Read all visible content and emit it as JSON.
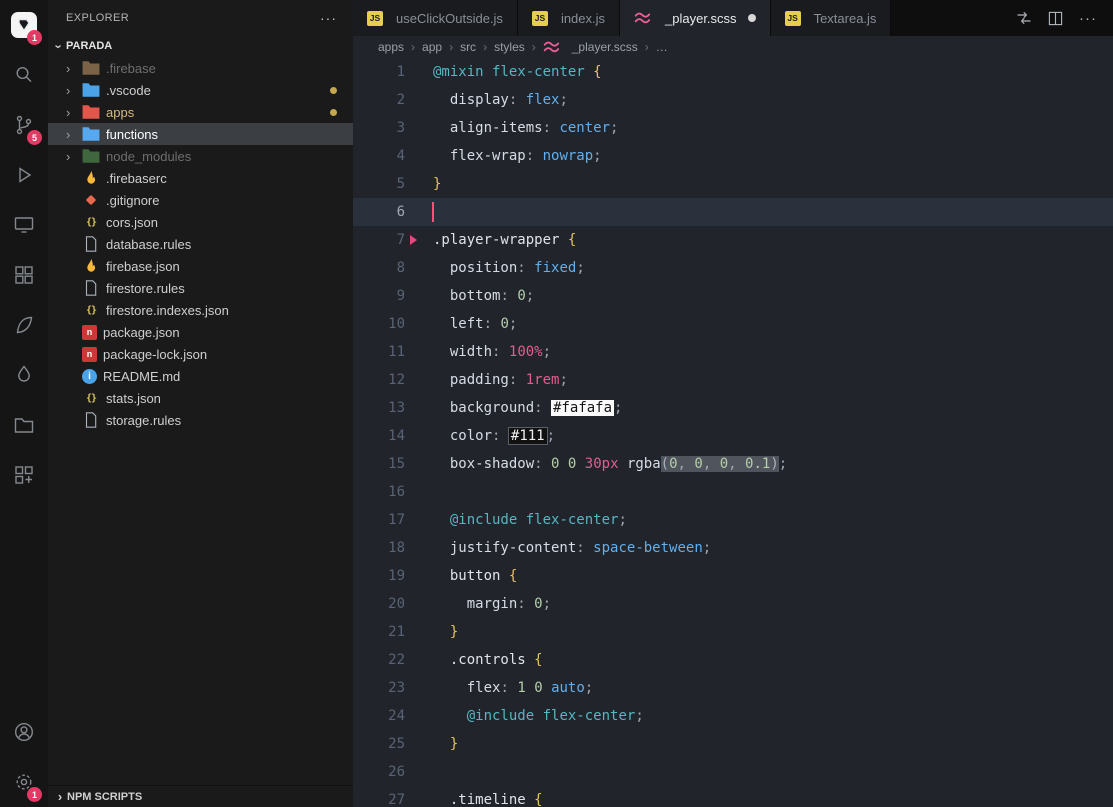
{
  "ui": {
    "more_icon": "···",
    "chevron": "›"
  },
  "activity_bar": {
    "top": [
      {
        "name": "explorer",
        "icon": "app-logo",
        "badge": "1",
        "active": true
      },
      {
        "name": "search",
        "icon": "search"
      },
      {
        "name": "source-control",
        "icon": "source-control",
        "badge": "5"
      },
      {
        "name": "run-debug",
        "icon": "run-debug"
      },
      {
        "name": "remote-explorer",
        "icon": "monitor"
      },
      {
        "name": "extensions",
        "icon": "extensions"
      },
      {
        "name": "extension-a",
        "icon": "leaf"
      },
      {
        "name": "extension-b",
        "icon": "droplet"
      },
      {
        "name": "project-manager",
        "icon": "folder-outline"
      },
      {
        "name": "extension-c",
        "icon": "grid"
      }
    ],
    "bottom": [
      {
        "name": "accounts",
        "icon": "account"
      },
      {
        "name": "settings",
        "icon": "gear",
        "badge": "1"
      }
    ]
  },
  "sidebar": {
    "title": "EXPLORER",
    "section": "PARADA",
    "footer": "NPM SCRIPTS",
    "tree": [
      {
        "label": ".firebase",
        "icon": "folder",
        "iconColor": "#c9a06a",
        "chevron": true,
        "dim": true
      },
      {
        "label": ".vscode",
        "icon": "folder",
        "iconColor": "#4aa3e8",
        "chevron": true,
        "dot": true
      },
      {
        "label": "apps",
        "icon": "folder",
        "iconColor": "#e2574c",
        "chevron": true,
        "dot": true,
        "modified": true
      },
      {
        "label": "functions",
        "icon": "folder",
        "iconColor": "#56a8f0",
        "chevron": true,
        "selected": true
      },
      {
        "label": "node_modules",
        "icon": "folder",
        "iconColor": "#5fa55f",
        "chevron": true,
        "dim": true
      },
      {
        "label": ".firebaserc",
        "icon": "flame",
        "iconColor": "#f6b93c"
      },
      {
        "label": ".gitignore",
        "icon": "git",
        "iconColor": "#e8694d"
      },
      {
        "label": "cors.json",
        "icon": "braces",
        "iconColor": "#d9c462"
      },
      {
        "label": "database.rules",
        "icon": "file",
        "iconColor": "#aab2bd"
      },
      {
        "label": "firebase.json",
        "icon": "flame",
        "iconColor": "#f6b93c"
      },
      {
        "label": "firestore.rules",
        "icon": "file",
        "iconColor": "#aab2bd"
      },
      {
        "label": "firestore.indexes.json",
        "icon": "braces",
        "iconColor": "#d9c462"
      },
      {
        "label": "package.json",
        "icon": "npm",
        "iconColor": "#cb3837"
      },
      {
        "label": "package-lock.json",
        "icon": "npm",
        "iconColor": "#cb3837"
      },
      {
        "label": "README.md",
        "icon": "info",
        "iconColor": "#4aa3e8"
      },
      {
        "label": "stats.json",
        "icon": "braces",
        "iconColor": "#d9c462"
      },
      {
        "label": "storage.rules",
        "icon": "file",
        "iconColor": "#aab2bd"
      }
    ]
  },
  "editor": {
    "tabs": [
      {
        "label": "useClickOutside.js",
        "icon": "js"
      },
      {
        "label": "index.js",
        "icon": "js"
      },
      {
        "label": "_player.scss",
        "icon": "sass",
        "active": true,
        "modified": true
      },
      {
        "label": "Textarea.js",
        "icon": "js"
      }
    ],
    "actions": [
      {
        "name": "open-changes"
      },
      {
        "name": "split-editor"
      },
      {
        "name": "more-actions"
      }
    ],
    "breadcrumbs": [
      {
        "label": "apps"
      },
      {
        "label": "app"
      },
      {
        "label": "src"
      },
      {
        "label": "styles"
      },
      {
        "label": "_player.scss",
        "icon": "sass"
      },
      {
        "label": "…"
      }
    ]
  },
  "code": {
    "language": "scss",
    "lines": [
      {
        "n": 1,
        "tokens": [
          [
            "@mixin",
            "at"
          ],
          [
            " "
          ],
          [
            "flex-center",
            "at"
          ],
          [
            " "
          ],
          [
            "{",
            "brace"
          ]
        ]
      },
      {
        "n": 2,
        "tokens": [
          [
            "  "
          ],
          [
            "display",
            "prop"
          ],
          [
            ":",
            "punct"
          ],
          [
            " "
          ],
          [
            "flex",
            "val"
          ],
          [
            ";",
            "punct"
          ]
        ]
      },
      {
        "n": 3,
        "tokens": [
          [
            "  "
          ],
          [
            "align-items",
            "prop"
          ],
          [
            ":",
            "punct"
          ],
          [
            " "
          ],
          [
            "center",
            "val"
          ],
          [
            ";",
            "punct"
          ]
        ]
      },
      {
        "n": 4,
        "tokens": [
          [
            "  "
          ],
          [
            "flex-wrap",
            "prop"
          ],
          [
            ":",
            "punct"
          ],
          [
            " "
          ],
          [
            "nowrap",
            "val"
          ],
          [
            ";",
            "punct"
          ]
        ]
      },
      {
        "n": 5,
        "tokens": [
          [
            "}",
            "brace"
          ]
        ]
      },
      {
        "n": 6,
        "current": true,
        "cursor": true,
        "tokens": []
      },
      {
        "n": 7,
        "marker": true,
        "tokens": [
          [
            ".player-wrapper",
            "sel"
          ],
          [
            " "
          ],
          [
            "{",
            "brace"
          ]
        ]
      },
      {
        "n": 8,
        "tokens": [
          [
            "  "
          ],
          [
            "position",
            "prop"
          ],
          [
            ":",
            "punct"
          ],
          [
            " "
          ],
          [
            "fixed",
            "val"
          ],
          [
            ";",
            "punct"
          ]
        ]
      },
      {
        "n": 9,
        "tokens": [
          [
            "  "
          ],
          [
            "bottom",
            "prop"
          ],
          [
            ":",
            "punct"
          ],
          [
            " "
          ],
          [
            "0",
            "num"
          ],
          [
            ";",
            "punct"
          ]
        ]
      },
      {
        "n": 10,
        "tokens": [
          [
            "  "
          ],
          [
            "left",
            "prop"
          ],
          [
            ":",
            "punct"
          ],
          [
            " "
          ],
          [
            "0",
            "num"
          ],
          [
            ";",
            "punct"
          ]
        ]
      },
      {
        "n": 11,
        "tokens": [
          [
            "  "
          ],
          [
            "width",
            "prop"
          ],
          [
            ":",
            "punct"
          ],
          [
            " "
          ],
          [
            "100%",
            "unit"
          ],
          [
            ";",
            "punct"
          ]
        ]
      },
      {
        "n": 12,
        "tokens": [
          [
            "  "
          ],
          [
            "padding",
            "prop"
          ],
          [
            ":",
            "punct"
          ],
          [
            " "
          ],
          [
            "1rem",
            "unit"
          ],
          [
            ";",
            "punct"
          ]
        ]
      },
      {
        "n": 13,
        "tokens": [
          [
            "  "
          ],
          [
            "background",
            "prop"
          ],
          [
            ":",
            "punct"
          ],
          [
            " "
          ],
          [
            "#fafafa",
            "swl"
          ],
          [
            ";",
            "punct"
          ]
        ]
      },
      {
        "n": 14,
        "tokens": [
          [
            "  "
          ],
          [
            "color",
            "prop"
          ],
          [
            ":",
            "punct"
          ],
          [
            " "
          ],
          [
            "#111",
            "swd"
          ],
          [
            ";",
            "punct"
          ]
        ]
      },
      {
        "n": 15,
        "tokens": [
          [
            "  "
          ],
          [
            "box-shadow",
            "prop"
          ],
          [
            ":",
            "punct"
          ],
          [
            " "
          ],
          [
            "0",
            "num"
          ],
          [
            " "
          ],
          [
            "0",
            "num"
          ],
          [
            " "
          ],
          [
            "30px",
            "unit"
          ],
          [
            " "
          ],
          [
            "rgba",
            "fn"
          ],
          [
            "(",
            "hl"
          ],
          [
            "0",
            "num hl"
          ],
          [
            ",",
            "punct hl"
          ],
          [
            " ",
            "hl"
          ],
          [
            "0",
            "num hl"
          ],
          [
            ",",
            "punct hl"
          ],
          [
            " ",
            "hl"
          ],
          [
            "0",
            "num hl"
          ],
          [
            ",",
            "punct hl"
          ],
          [
            " ",
            "hl"
          ],
          [
            "0.1",
            "num hl"
          ],
          [
            ")",
            "hl"
          ],
          [
            ";",
            "punct"
          ]
        ]
      },
      {
        "n": 16,
        "tokens": []
      },
      {
        "n": 17,
        "tokens": [
          [
            "  "
          ],
          [
            "@include",
            "at"
          ],
          [
            " "
          ],
          [
            "flex-center",
            "at"
          ],
          [
            ";",
            "punct"
          ]
        ]
      },
      {
        "n": 18,
        "tokens": [
          [
            "  "
          ],
          [
            "justify-content",
            "prop"
          ],
          [
            ":",
            "punct"
          ],
          [
            " "
          ],
          [
            "space-between",
            "val"
          ],
          [
            ";",
            "punct"
          ]
        ]
      },
      {
        "n": 19,
        "tokens": [
          [
            "  "
          ],
          [
            "button",
            "sel"
          ],
          [
            " "
          ],
          [
            "{",
            "brace"
          ]
        ]
      },
      {
        "n": 20,
        "tokens": [
          [
            "    "
          ],
          [
            "margin",
            "prop"
          ],
          [
            ":",
            "punct"
          ],
          [
            " "
          ],
          [
            "0",
            "num"
          ],
          [
            ";",
            "punct"
          ]
        ]
      },
      {
        "n": 21,
        "tokens": [
          [
            "  "
          ],
          [
            "}",
            "brace"
          ]
        ]
      },
      {
        "n": 22,
        "tokens": [
          [
            "  "
          ],
          [
            ".controls",
            "sel"
          ],
          [
            " "
          ],
          [
            "{",
            "brace"
          ]
        ]
      },
      {
        "n": 23,
        "tokens": [
          [
            "    "
          ],
          [
            "flex",
            "prop"
          ],
          [
            ":",
            "punct"
          ],
          [
            " "
          ],
          [
            "1",
            "num"
          ],
          [
            " "
          ],
          [
            "0",
            "num"
          ],
          [
            " "
          ],
          [
            "auto",
            "val"
          ],
          [
            ";",
            "punct"
          ]
        ]
      },
      {
        "n": 24,
        "tokens": [
          [
            "    "
          ],
          [
            "@include",
            "at"
          ],
          [
            " "
          ],
          [
            "flex-center",
            "at"
          ],
          [
            ";",
            "punct"
          ]
        ]
      },
      {
        "n": 25,
        "tokens": [
          [
            "  "
          ],
          [
            "}",
            "brace"
          ]
        ]
      },
      {
        "n": 26,
        "tokens": []
      },
      {
        "n": 27,
        "tokens": [
          [
            "  "
          ],
          [
            ".timeline",
            "sel"
          ],
          [
            " "
          ],
          [
            "{",
            "brace"
          ]
        ]
      }
    ]
  }
}
